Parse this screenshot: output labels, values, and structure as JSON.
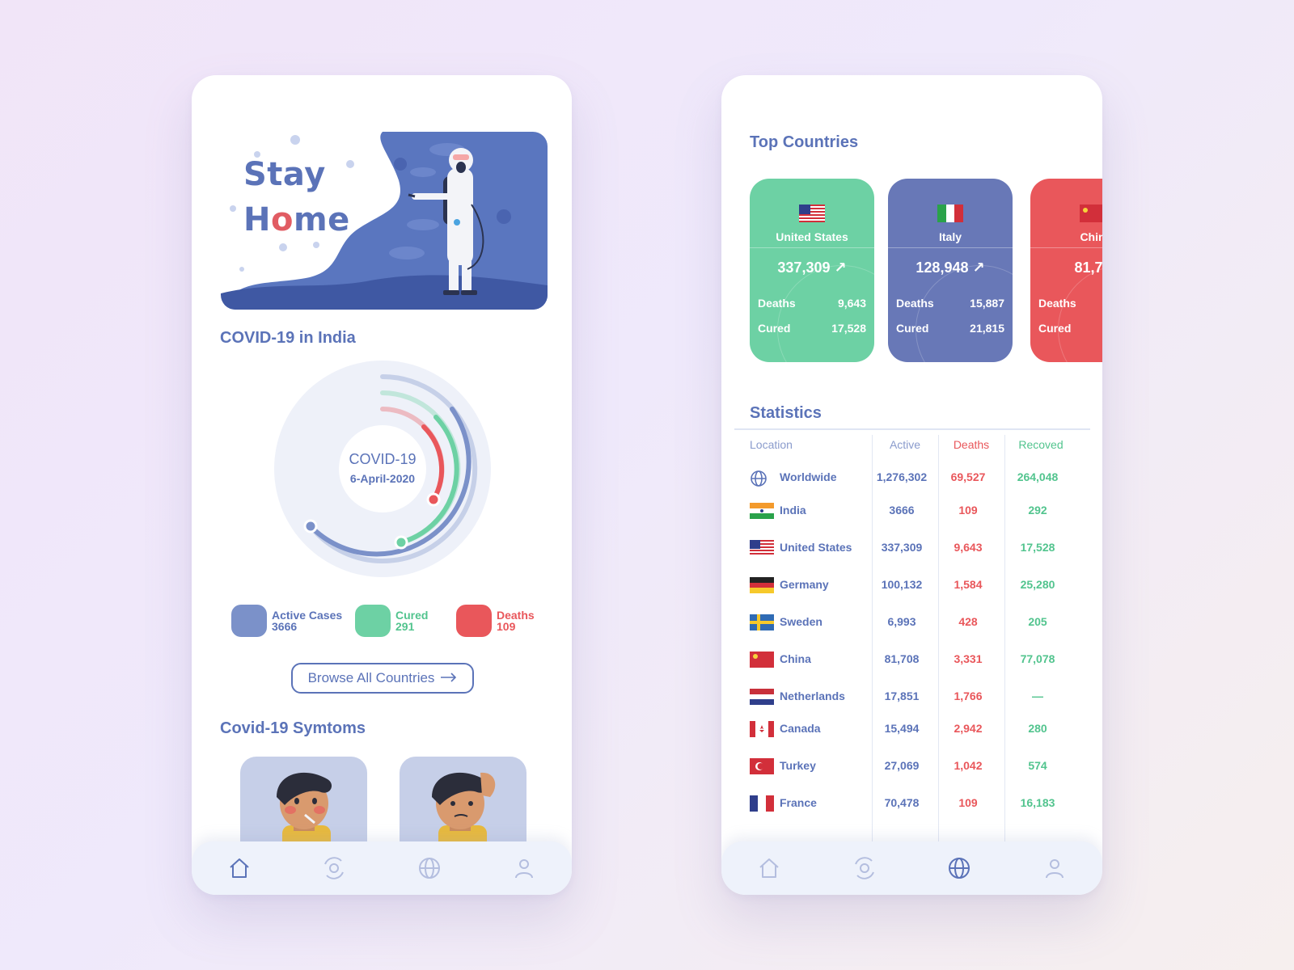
{
  "colors": {
    "primary": "#5b73b8",
    "active": "#7b91c9",
    "cured": "#6dd1a4",
    "deaths": "#e9575b",
    "card_us": "#6dd1a4",
    "card_italy": "#6878b7",
    "card_china": "#e9575b"
  },
  "left": {
    "hero": {
      "line1": "Stay",
      "line2_a": "H",
      "line2_o": "o",
      "line2_b": "me"
    },
    "india_title": "COVID-19 in India",
    "donut": {
      "label": "COVID-19",
      "date": "6-April-2020"
    },
    "legend": [
      {
        "label": "Active Cases",
        "value": "3666",
        "color": "#7b91c9"
      },
      {
        "label": "Cured",
        "value": "291",
        "color": "#6dd1a4"
      },
      {
        "label": "Deaths",
        "value": "109",
        "color": "#e9575b"
      }
    ],
    "browse_button": "Browse All Countries",
    "symptoms_title": "Covid-19 Symtoms",
    "nav": [
      {
        "icon": "home-icon",
        "active": true
      },
      {
        "icon": "virus-scan-icon",
        "active": false
      },
      {
        "icon": "globe-icon",
        "active": false
      },
      {
        "icon": "user-icon",
        "active": false
      }
    ]
  },
  "right": {
    "top_countries_title": "Top Countries",
    "cards": [
      {
        "name": "United States",
        "total": "337,309",
        "deaths_label": "Deaths",
        "deaths": "9,643",
        "cured_label": "Cured",
        "cured": "17,528"
      },
      {
        "name": "Italy",
        "total": "128,948",
        "deaths_label": "Deaths",
        "deaths": "15,887",
        "cured_label": "Cured",
        "cured": "21,815"
      },
      {
        "name": "Chin",
        "total": "81,70",
        "deaths_label": "Deaths",
        "deaths": "",
        "cured_label": "Cured",
        "cured": ""
      }
    ],
    "statistics_title": "Statistics",
    "table": {
      "headers": {
        "location": "Location",
        "active": "Active",
        "deaths": "Deaths",
        "recovered": "Recoved"
      },
      "rows": [
        {
          "location": "Worldwide",
          "active": "1,276,302",
          "deaths": "69,527",
          "recovered": "264,048",
          "flag": "globe"
        },
        {
          "location": "India",
          "active": "3666",
          "deaths": "109",
          "recovered": "292",
          "flag": "india"
        },
        {
          "location": "United States",
          "active": "337,309",
          "deaths": "9,643",
          "recovered": "17,528",
          "flag": "us"
        },
        {
          "location": "Germany",
          "active": "100,132",
          "deaths": "1,584",
          "recovered": "25,280",
          "flag": "germany"
        },
        {
          "location": "Sweden",
          "active": "6,993",
          "deaths": "428",
          "recovered": "205",
          "flag": "sweden"
        },
        {
          "location": "China",
          "active": "81,708",
          "deaths": "3,331",
          "recovered": "77,078",
          "flag": "china"
        },
        {
          "location": "Netherlands",
          "active": "17,851",
          "deaths": "1,766",
          "recovered": "—",
          "flag": "netherlands"
        },
        {
          "location": "Canada",
          "active": "15,494",
          "deaths": "2,942",
          "recovered": "280",
          "flag": "canada"
        },
        {
          "location": "Turkey",
          "active": "27,069",
          "deaths": "1,042",
          "recovered": "574",
          "flag": "turkey"
        },
        {
          "location": "France",
          "active": "70,478",
          "deaths": "109",
          "recovered": "16,183",
          "flag": "france"
        }
      ]
    },
    "nav": [
      {
        "icon": "home-icon",
        "active": false
      },
      {
        "icon": "virus-scan-icon",
        "active": false
      },
      {
        "icon": "globe-icon",
        "active": true
      },
      {
        "icon": "user-icon",
        "active": false
      }
    ]
  }
}
